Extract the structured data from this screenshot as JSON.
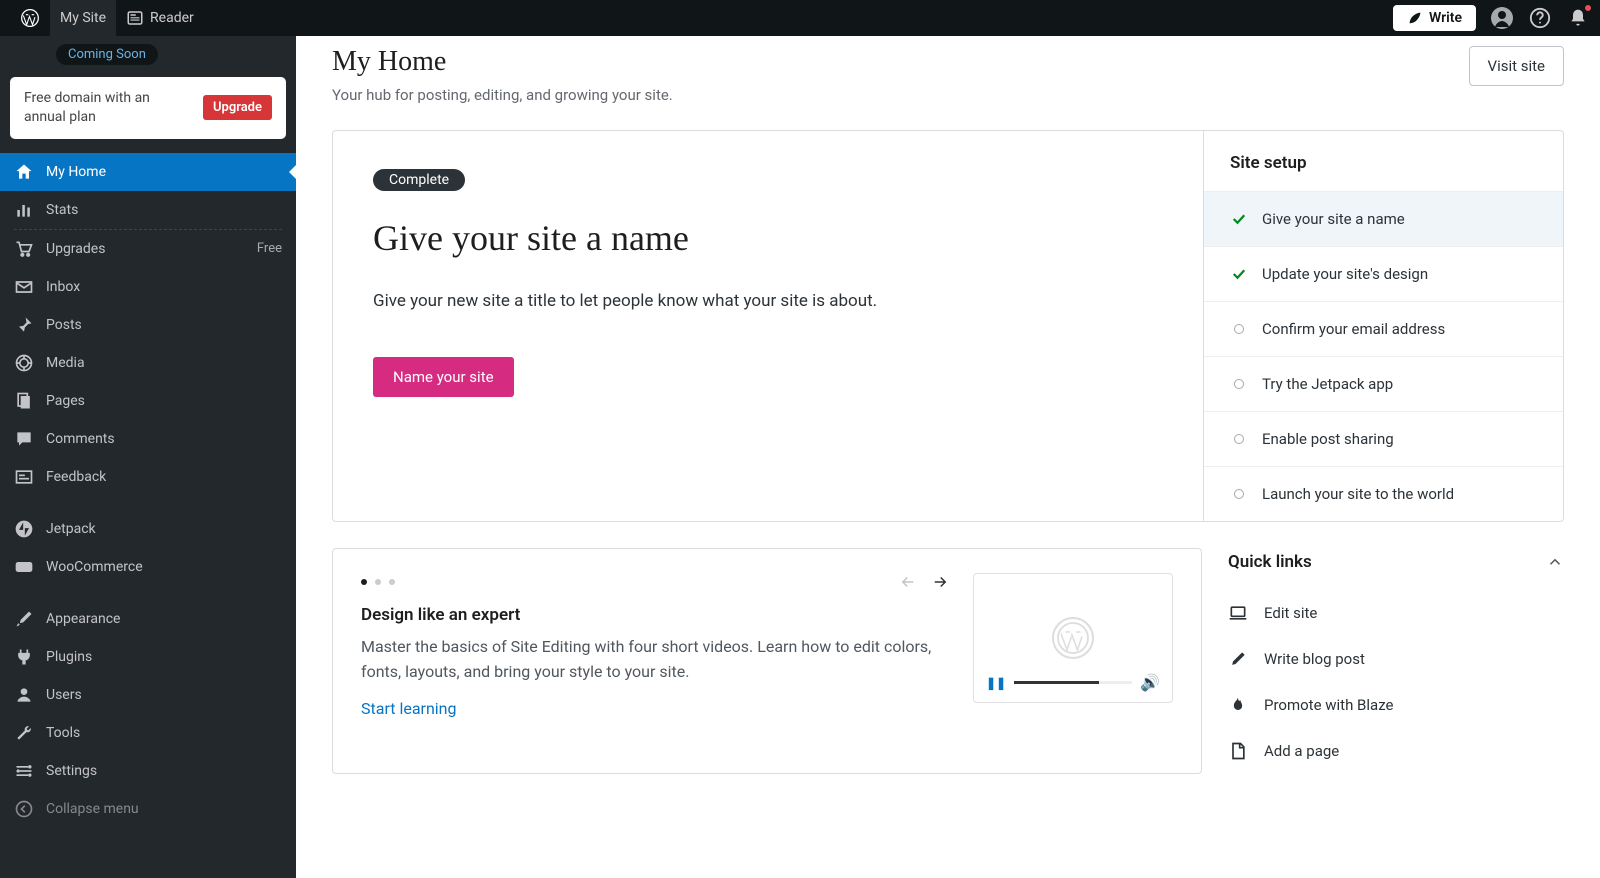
{
  "topbar": {
    "my_site": "My Site",
    "reader": "Reader",
    "write": "Write"
  },
  "sidebar": {
    "coming_soon": "Coming Soon",
    "upgrade_card_text": "Free domain with an annual plan",
    "upgrade_btn": "Upgrade",
    "items": [
      {
        "label": "My Home",
        "icon": "home"
      },
      {
        "label": "Stats",
        "icon": "stats"
      },
      {
        "label": "Upgrades",
        "icon": "cart",
        "badge": "Free"
      },
      {
        "label": "Inbox",
        "icon": "mail"
      },
      {
        "label": "Posts",
        "icon": "pin"
      },
      {
        "label": "Media",
        "icon": "media"
      },
      {
        "label": "Pages",
        "icon": "pages"
      },
      {
        "label": "Comments",
        "icon": "comment"
      },
      {
        "label": "Feedback",
        "icon": "feedback"
      },
      {
        "label": "Jetpack",
        "icon": "jetpack"
      },
      {
        "label": "WooCommerce",
        "icon": "woo"
      },
      {
        "label": "Appearance",
        "icon": "brush"
      },
      {
        "label": "Plugins",
        "icon": "plug"
      },
      {
        "label": "Users",
        "icon": "user"
      },
      {
        "label": "Tools",
        "icon": "wrench"
      },
      {
        "label": "Settings",
        "icon": "settings"
      },
      {
        "label": "Collapse menu",
        "icon": "collapse"
      }
    ]
  },
  "page": {
    "title": "My Home",
    "subtitle": "Your hub for posting, editing, and growing your site.",
    "visit": "Visit site"
  },
  "setup": {
    "complete": "Complete",
    "heading": "Give your site a name",
    "description": "Give your new site a title to let people know what your site is about.",
    "cta": "Name your site",
    "panel_title": "Site setup",
    "steps": [
      {
        "label": "Give your site a name",
        "done": true
      },
      {
        "label": "Update your site's design",
        "done": true
      },
      {
        "label": "Confirm your email address",
        "done": false
      },
      {
        "label": "Try the Jetpack app",
        "done": false
      },
      {
        "label": "Enable post sharing",
        "done": false
      },
      {
        "label": "Launch your site to the world",
        "done": false
      }
    ]
  },
  "learn": {
    "title": "Design like an expert",
    "desc": "Master the basics of Site Editing with four short videos. Learn how to edit colors, fonts, layouts, and bring your style to your site.",
    "link": "Start learning"
  },
  "quick_links": {
    "title": "Quick links",
    "items": [
      {
        "label": "Edit site",
        "icon": "laptop"
      },
      {
        "label": "Write blog post",
        "icon": "pencil"
      },
      {
        "label": "Promote with Blaze",
        "icon": "flame"
      },
      {
        "label": "Add a page",
        "icon": "page"
      }
    ]
  }
}
